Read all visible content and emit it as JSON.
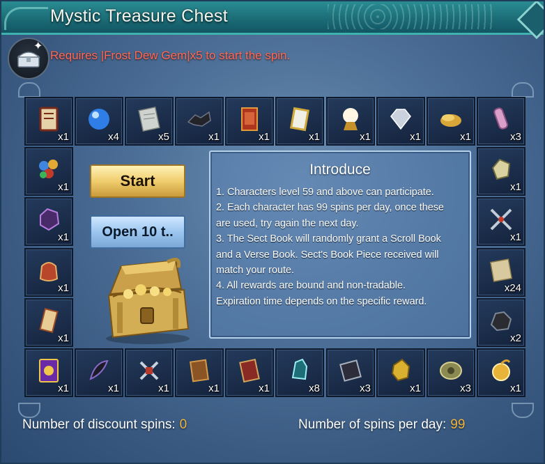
{
  "window": {
    "title": "Mystic Treasure Chest"
  },
  "requirement": "Requires |Frost Dew Gem|x5 to start the spin.",
  "buttons": {
    "start": "Start",
    "open10": "Open 10 t.."
  },
  "intro": {
    "title": "Introduce",
    "lines": [
      "1. Characters level 59 and above can participate.",
      "2. Each character has 99 spins per day, once these are used, try again the next day.",
      "3. The Sect Book will randomly grant a Scroll Book and a Verse Book. Sect's Book Piece received will match your route.",
      "4. All rewards are bound and non-tradable. Expiration time depends on the specific reward."
    ]
  },
  "footer": {
    "discount_label": "Number of discount spins:",
    "discount_value": "0",
    "perday_label": "Number of spins per day:",
    "perday_value": "99"
  },
  "rewards": {
    "top": [
      {
        "icon": "recipe-scroll-icon",
        "qty": "x1"
      },
      {
        "icon": "blue-orb-icon",
        "qty": "x4"
      },
      {
        "icon": "paper-note-icon",
        "qty": "x5"
      },
      {
        "icon": "black-fragment-icon",
        "qty": "x1"
      },
      {
        "icon": "red-scroll-icon",
        "qty": "x1"
      },
      {
        "icon": "gold-card-icon",
        "qty": "x1"
      },
      {
        "icon": "crystal-ball-icon",
        "qty": "x1"
      },
      {
        "icon": "diamond-gem-icon",
        "qty": "x1"
      },
      {
        "icon": "gold-nugget-icon",
        "qty": "x1"
      },
      {
        "icon": "pink-vial-icon",
        "qty": "x3"
      }
    ],
    "left": [
      {
        "icon": "gem-bundle-icon",
        "qty": "x1"
      },
      {
        "icon": "purple-stone-icon",
        "qty": "x1"
      },
      {
        "icon": "red-pouch-icon",
        "qty": "x1"
      },
      {
        "icon": "scroll-note-icon",
        "qty": "x1"
      }
    ],
    "right": [
      {
        "icon": "jade-stone-icon",
        "qty": "x1"
      },
      {
        "icon": "crossed-swords-icon",
        "qty": "x1"
      },
      {
        "icon": "map-scroll-icon",
        "qty": "x24"
      },
      {
        "icon": "black-ore-icon",
        "qty": "x2"
      }
    ],
    "bottom": [
      {
        "icon": "purple-card-icon",
        "qty": "x1"
      },
      {
        "icon": "dark-feather-icon",
        "qty": "x1"
      },
      {
        "icon": "sword-emblem-icon",
        "qty": "x1"
      },
      {
        "icon": "brown-book-icon",
        "qty": "x1"
      },
      {
        "icon": "red-book-icon",
        "qty": "x1"
      },
      {
        "icon": "teal-crystal-icon",
        "qty": "x8"
      },
      {
        "icon": "dark-book-icon",
        "qty": "x3"
      },
      {
        "icon": "gold-ore-icon",
        "qty": "x1"
      },
      {
        "icon": "jade-pendant-icon",
        "qty": "x3"
      },
      {
        "icon": "gold-coin-icon",
        "qty": "x1"
      }
    ]
  },
  "colors": {
    "accent": "#f2b53a",
    "requirement": "#ff6a57",
    "titlebar": "#1c6d77"
  }
}
